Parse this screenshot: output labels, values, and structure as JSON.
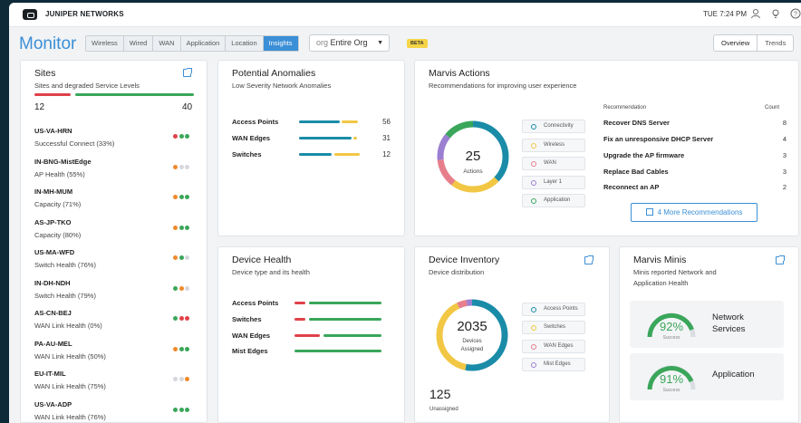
{
  "brand": "JUNIPER NETWORKS",
  "clock": "TUE 7:24 PM",
  "page_title": "Monitor",
  "tabs": [
    "Wireless",
    "Wired",
    "WAN",
    "Application",
    "Location",
    "Insights"
  ],
  "active_tab": "Insights",
  "org_select": {
    "prefix": "org",
    "value": "Entire Org"
  },
  "beta_badge": "BETA",
  "view_toggle": [
    "Overview",
    "Trends"
  ],
  "colors": {
    "accent": "#3b8fd6",
    "teal": "#1a8ca8",
    "yellow": "#f2c744",
    "green": "#3aa65a",
    "red": "#e0414a",
    "orange": "#f08a2c",
    "purple": "#9b7fd1",
    "pink": "#e77e8b"
  },
  "sites": {
    "title": "Sites",
    "subtitle": "Sites and degraded Service Levels",
    "degraded_count": "12",
    "healthy_count": "40",
    "items": [
      {
        "name": "US-VA-HRN",
        "detail": "Successful Connect (33%)",
        "dots": [
          "red",
          "green",
          "green"
        ]
      },
      {
        "name": "IN-BNG-MistEdge",
        "detail": "AP Health (55%)",
        "dots": [
          "orange",
          "gray",
          "gray"
        ]
      },
      {
        "name": "IN-MH-MUM",
        "detail": "Capacity (71%)",
        "dots": [
          "orange",
          "green",
          "green"
        ]
      },
      {
        "name": "AS-JP-TKO",
        "detail": "Capacity (80%)",
        "dots": [
          "orange",
          "green",
          "green"
        ]
      },
      {
        "name": "US-MA-WFD",
        "detail": "Switch Health (76%)",
        "dots": [
          "orange",
          "green",
          "gray"
        ]
      },
      {
        "name": "IN-DH-NDH",
        "detail": "Switch Health (79%)",
        "dots": [
          "green",
          "orange",
          "gray"
        ]
      },
      {
        "name": "AS-CN-BEJ",
        "detail": "WAN Link Health (0%)",
        "dots": [
          "green",
          "red",
          "red"
        ]
      },
      {
        "name": "PA-AU-MEL",
        "detail": "WAN Link Health (50%)",
        "dots": [
          "orange",
          "green",
          "green"
        ]
      },
      {
        "name": "EU-IT-MIL",
        "detail": "WAN Link Health (75%)",
        "dots": [
          "gray",
          "gray",
          "orange"
        ]
      },
      {
        "name": "US-VA-ADP",
        "detail": "WAN Link Health (76%)",
        "dots": [
          "green",
          "green",
          "green"
        ]
      }
    ]
  },
  "anomalies": {
    "title": "Potential Anomalies",
    "subtitle": "Low Severity Network Anomalies",
    "rows": [
      {
        "label": "Access Points",
        "value": "56"
      },
      {
        "label": "WAN Edges",
        "value": "31"
      },
      {
        "label": "Switches",
        "value": "12"
      }
    ]
  },
  "marvis_actions": {
    "title": "Marvis Actions",
    "subtitle": "Recommendations for improving user experience",
    "donut_value": "25",
    "donut_label": "Actions",
    "legend": [
      "Connectivity",
      "Wireless",
      "WAN",
      "Layer 1",
      "Application"
    ],
    "rec_header": "Recommendation",
    "count_header": "Count",
    "recommendations": [
      {
        "name": "Recover DNS Server",
        "count": "8"
      },
      {
        "name": "Fix an unresponsive DHCP Server",
        "count": "4"
      },
      {
        "name": "Upgrade the AP firmware",
        "count": "3"
      },
      {
        "name": "Replace Bad Cables",
        "count": "3"
      },
      {
        "name": "Reconnect an AP",
        "count": "2"
      }
    ],
    "more_button": "4 More Recommendations"
  },
  "device_health": {
    "title": "Device Health",
    "subtitle": "Device type and its health",
    "rows": [
      "Access Points",
      "Switches",
      "WAN Edges",
      "Mist Edges"
    ]
  },
  "inventory": {
    "title": "Device Inventory",
    "subtitle": "Device distribution",
    "donut_value": "2035",
    "donut_label_1": "Devices",
    "donut_label_2": "Assigned",
    "unassigned_value": "125",
    "unassigned_label": "Unassigned",
    "legend": [
      "Access Points",
      "Switches",
      "WAN Edges",
      "Mist Edges"
    ]
  },
  "minis": {
    "title": "Marvis Minis",
    "subtitle_1": "Minis reported Network and",
    "subtitle_2": "Application Health",
    "items": [
      {
        "percent": "92%",
        "status": "Success",
        "label_1": "Network",
        "label_2": "Services"
      },
      {
        "percent": "91%",
        "status": "Success",
        "label_1": "Application",
        "label_2": ""
      }
    ]
  }
}
